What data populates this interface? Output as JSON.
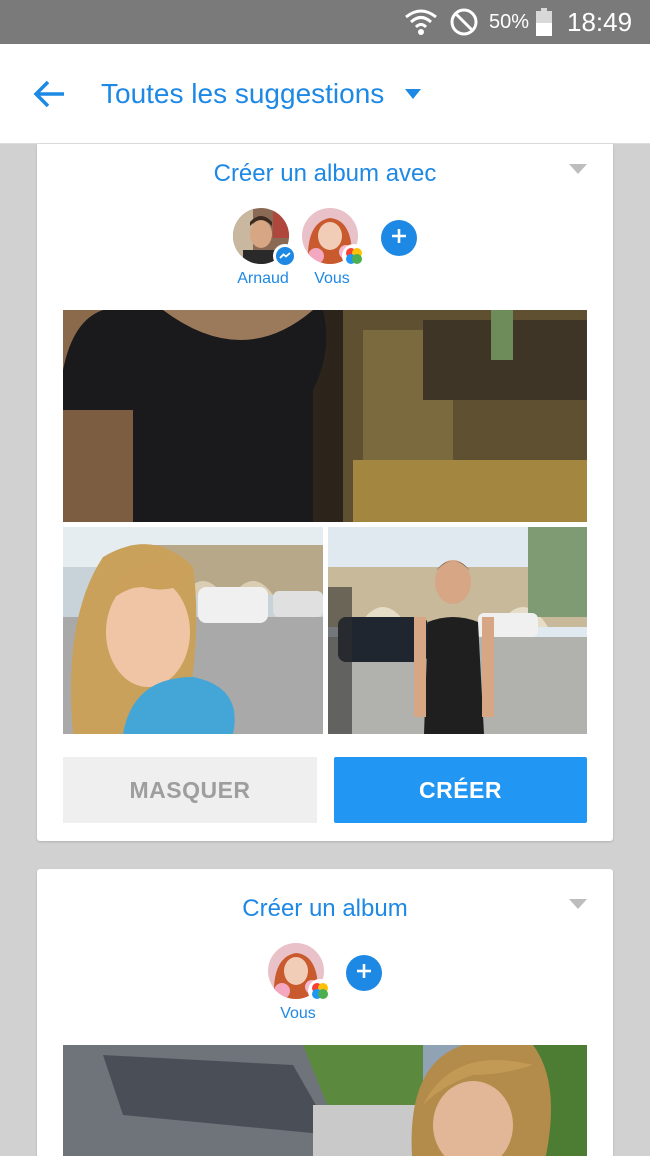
{
  "status_bar": {
    "battery_percent": "50%",
    "time": "18:49",
    "icons": [
      "wifi-icon",
      "do-not-disturb-icon",
      "battery-icon"
    ]
  },
  "app_bar": {
    "back_icon": "back-arrow-icon",
    "title": "Toutes les suggestions",
    "dropdown_icon": "dropdown-caret-icon"
  },
  "cards": [
    {
      "title": "Créer un album avec",
      "menu_icon": "card-menu-caret-icon",
      "participants": [
        {
          "name": "Arnaud",
          "badge": "messenger-badge-icon"
        },
        {
          "name": "Vous",
          "badge": "memories-badge-icon"
        }
      ],
      "add_icon": "add-person-icon",
      "photos": [
        "photo-wide",
        "photo-left",
        "photo-right"
      ],
      "hide_label": "MASQUER",
      "create_label": "CRÉER"
    },
    {
      "title": "Créer un album",
      "menu_icon": "card-menu-caret-icon",
      "participants": [
        {
          "name": "Vous",
          "badge": "memories-badge-icon"
        }
      ],
      "add_icon": "add-person-icon",
      "photos": [
        "photo-wide"
      ]
    }
  ],
  "colors": {
    "accent": "#1e88e5",
    "primary_button": "#2196f3",
    "background": "#d1d1d1",
    "status_bar": "#7a7a7a"
  }
}
